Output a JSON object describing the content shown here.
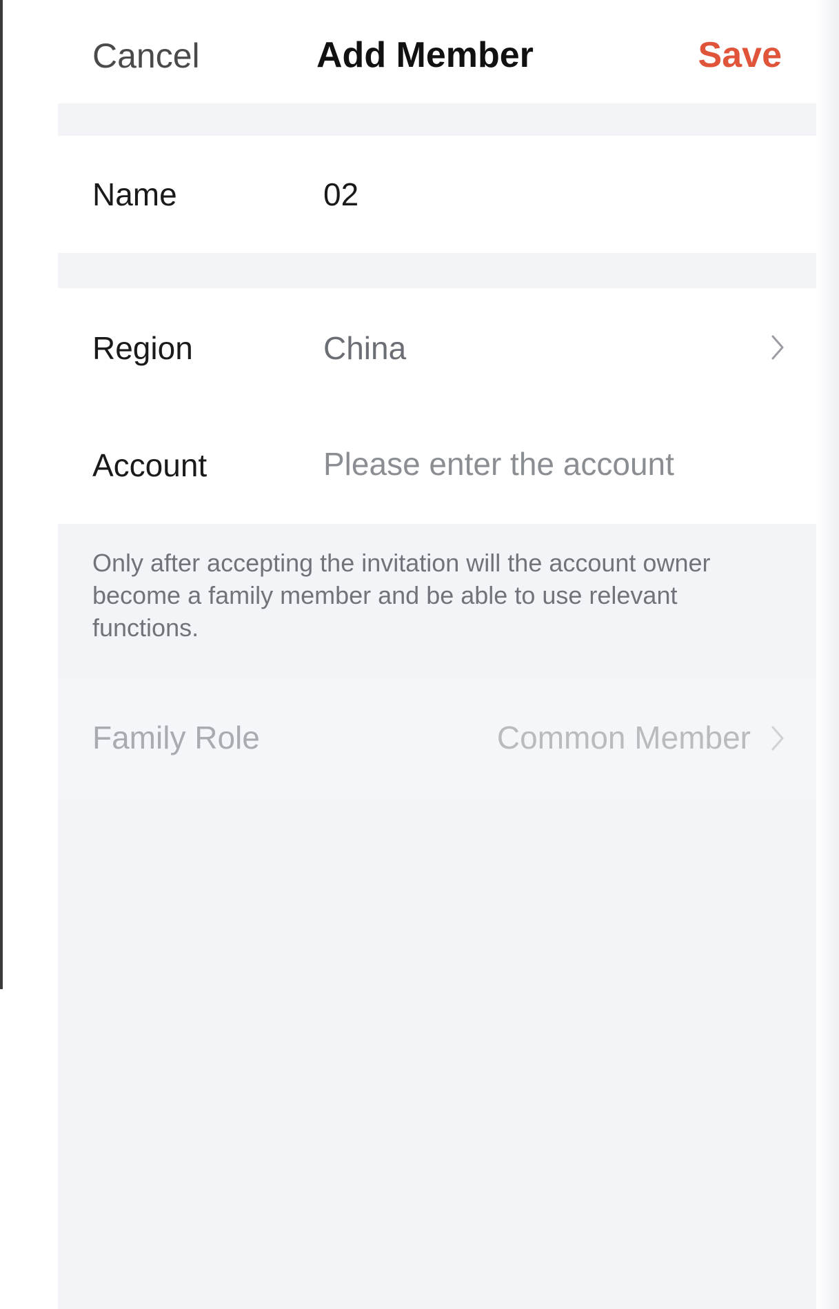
{
  "header": {
    "cancel_label": "Cancel",
    "title": "Add Member",
    "save_label": "Save"
  },
  "form": {
    "name": {
      "label": "Name",
      "value": "02"
    },
    "region": {
      "label": "Region",
      "value": "China"
    },
    "account": {
      "label": "Account",
      "value": "",
      "placeholder": "Please enter the account"
    },
    "notice": "Only after accepting the invitation will the account owner become a family member and be able to use relevant functions.",
    "family_role": {
      "label": "Family Role",
      "value": "Common Member"
    }
  },
  "colors": {
    "accent": "#e0553a",
    "background": "#f3f4f7",
    "card": "#ffffff",
    "disabled_text": "#a9abb0"
  },
  "icons": {
    "region_chevron": "chevron-right-icon",
    "role_chevron": "chevron-right-icon"
  }
}
